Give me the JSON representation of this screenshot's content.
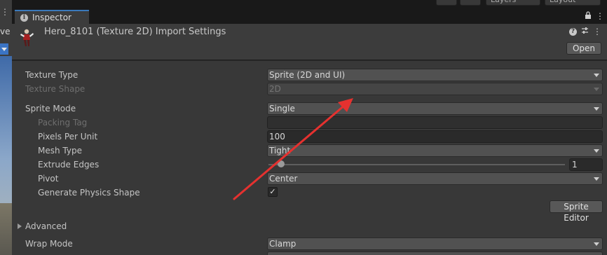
{
  "toolbar": {
    "layers_label": "Layers",
    "layout_label": "Layout"
  },
  "scene_panel": {
    "partial_label": "ve"
  },
  "tab": {
    "title": "Inspector"
  },
  "header": {
    "title": "Hero_8101 (Texture 2D) Import Settings",
    "open_label": "Open"
  },
  "fields": {
    "texture_type": {
      "label": "Texture Type",
      "value": "Sprite (2D and UI)"
    },
    "texture_shape": {
      "label": "Texture Shape",
      "value": "2D"
    },
    "sprite_mode": {
      "label": "Sprite Mode",
      "value": "Single"
    },
    "packing_tag": {
      "label": "Packing Tag",
      "value": ""
    },
    "pixels_per_unit": {
      "label": "Pixels Per Unit",
      "value": "100"
    },
    "mesh_type": {
      "label": "Mesh Type",
      "value": "Tight"
    },
    "extrude_edges": {
      "label": "Extrude Edges",
      "value": "1",
      "fraction": 0.03
    },
    "pivot": {
      "label": "Pivot",
      "value": "Center"
    },
    "generate_physics_shape": {
      "label": "Generate Physics Shape",
      "checked": true
    },
    "sprite_editor": {
      "label": "Sprite Editor"
    },
    "advanced": {
      "label": "Advanced"
    },
    "wrap_mode": {
      "label": "Wrap Mode",
      "value": "Clamp"
    }
  },
  "colors": {
    "accent": "#3a79bb",
    "annotation_arrow": "#e5312f"
  }
}
